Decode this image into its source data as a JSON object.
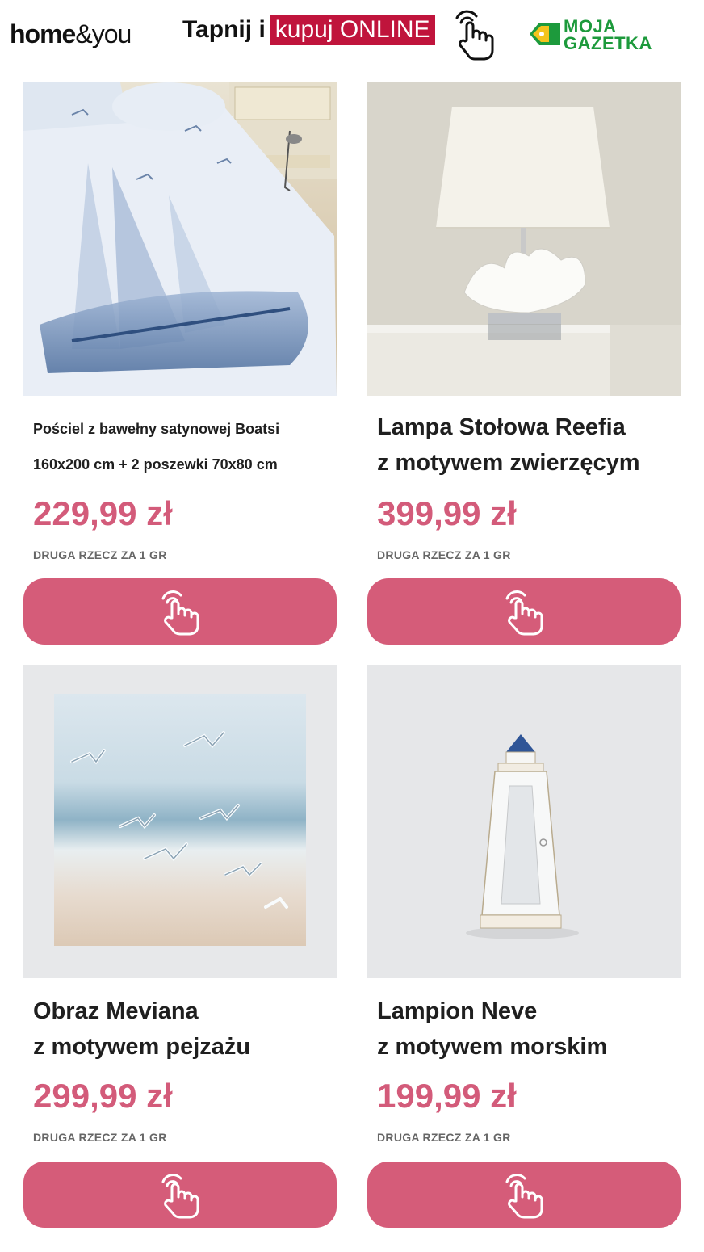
{
  "header": {
    "brand_home": "home",
    "brand_amp": "&you",
    "cta_prefix": "Tapnij i",
    "cta_highlight": "kupuj ONLINE",
    "gazetka_line1": "MOJA",
    "gazetka_line2": "GAZETKA"
  },
  "colors": {
    "accent": "#d55c79",
    "price": "#d35b7a",
    "cta_highlight": "#c0143c",
    "gazetka_green": "#1d9a3c"
  },
  "products": [
    {
      "title_line1": "Pościel z bawełny satynowej Boatsi",
      "title_line2": "160x200 cm + 2 poszewki 70x80 cm",
      "price": "229,99 zł",
      "promo": "DRUGA RZECZ ZA 1 GR",
      "icon": "tap-hand-icon"
    },
    {
      "title_line1": "Lampa Stołowa Reefia",
      "title_line2": "z motywem zwierzęcym",
      "price": "399,99 zł",
      "promo": "DRUGA RZECZ ZA 1 GR",
      "icon": "tap-hand-icon"
    },
    {
      "title_line1": "Obraz Meviana",
      "title_line2": "z motywem pejzażu",
      "price": "299,99 zł",
      "promo": "DRUGA RZECZ ZA 1 GR",
      "icon": "tap-hand-icon"
    },
    {
      "title_line1": "Lampion Neve",
      "title_line2": "z motywem morskim",
      "price": "199,99 zł",
      "promo": "DRUGA RZECZ ZA 1 GR",
      "icon": "tap-hand-icon"
    }
  ]
}
